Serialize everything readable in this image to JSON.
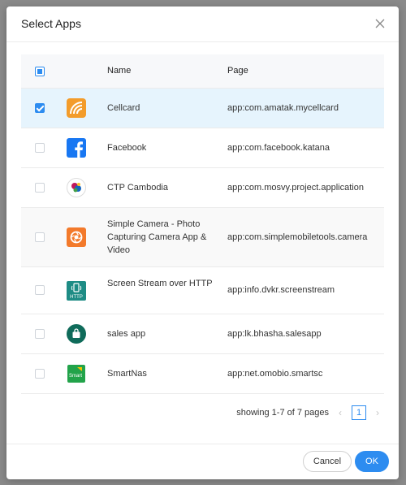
{
  "dialog": {
    "title": "Select Apps"
  },
  "table": {
    "headers": {
      "name": "Name",
      "page": "Page"
    },
    "rows": [
      {
        "name": "Cellcard",
        "page": "app:com.amatak.mycellcard",
        "checked": true,
        "icon": "cellcard-icon"
      },
      {
        "name": "Facebook",
        "page": "app:com.facebook.katana",
        "checked": false,
        "icon": "facebook-icon"
      },
      {
        "name": "CTP Cambodia",
        "page": "app:com.mosvy.project.application",
        "checked": false,
        "icon": "ctp-cambodia-icon"
      },
      {
        "name": "Simple Camera - Photo Capturing Camera App & Video",
        "page": "app:com.simplemobiletools.camera",
        "checked": false,
        "icon": "camera-icon"
      },
      {
        "name": "Screen Stream over HTTP",
        "page": "app:info.dvkr.screenstream",
        "checked": false,
        "icon": "screen-stream-icon"
      },
      {
        "name": "sales app",
        "page": "app:lk.bhasha.salesapp",
        "checked": false,
        "icon": "shopping-bag-icon"
      },
      {
        "name": "SmartNas",
        "page": "app:net.omobio.smartsc",
        "checked": false,
        "icon": "smartnas-icon"
      }
    ]
  },
  "pagination": {
    "summary": "showing 1-7 of 7 pages",
    "current_page": "1"
  },
  "footer": {
    "cancel_label": "Cancel",
    "ok_label": "OK"
  },
  "colors": {
    "accent": "#2d8cf0",
    "selected_row": "#e6f4fd"
  }
}
